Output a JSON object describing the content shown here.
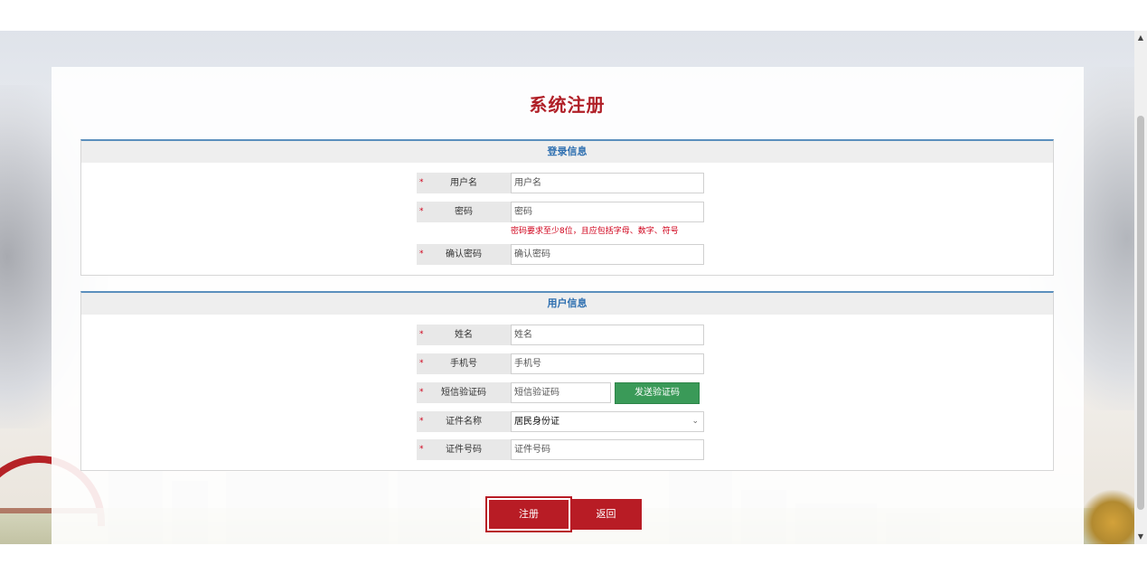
{
  "page_title": "系统注册",
  "login_section": {
    "heading": "登录信息",
    "username": {
      "label": "用户名",
      "placeholder": "用户名",
      "required": "*"
    },
    "password": {
      "label": "密码",
      "placeholder": "密码",
      "required": "*",
      "hint": "密码要求至少8位，且应包括字母、数字、符号"
    },
    "confirm_password": {
      "label": "确认密码",
      "placeholder": "确认密码",
      "required": "*"
    }
  },
  "user_section": {
    "heading": "用户信息",
    "name": {
      "label": "姓名",
      "placeholder": "姓名",
      "required": "*"
    },
    "phone": {
      "label": "手机号",
      "placeholder": "手机号",
      "required": "*"
    },
    "sms_code": {
      "label": "短信验证码",
      "placeholder": "短信验证码",
      "required": "*",
      "send_button": "发送验证码"
    },
    "id_type": {
      "label": "证件名称",
      "value": "居民身份证",
      "required": "*"
    },
    "id_number": {
      "label": "证件号码",
      "placeholder": "证件号码",
      "required": "*"
    }
  },
  "actions": {
    "register": "注册",
    "back": "返回"
  },
  "colors": {
    "accent": "#b01f27",
    "section_heading": "#2e6fb0",
    "send_button": "#3a9a58",
    "error": "#d0021b"
  }
}
